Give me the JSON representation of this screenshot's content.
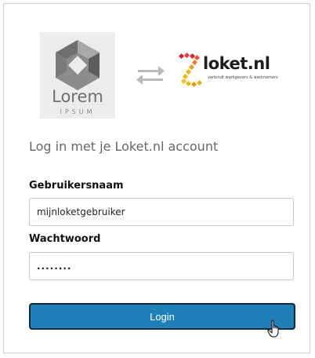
{
  "branding": {
    "lorem_word": "Lorem",
    "ipsum_word": "IPSUM",
    "loket_word": "loket.nl",
    "loket_tagline": "verbindt werkgevers & werknemers"
  },
  "icons": {
    "lorem_logo": "lorem-ipsum-hexagon-logo",
    "swap": "swap-arrows-icon",
    "loket_mark": "loket-z-mark-icon",
    "cursor": "hand-pointer-cursor"
  },
  "login": {
    "title": "Log in met je Loket.nl account",
    "username_label": "Gebruikersnaam",
    "username_value": "mijnloketgebruiker",
    "password_label": "Wachtwoord",
    "password_value": "........",
    "submit_label": "Login"
  },
  "colors": {
    "button": "#1f7fb8",
    "loket_red": "#d7262b",
    "loket_yellow": "#f2b705"
  }
}
